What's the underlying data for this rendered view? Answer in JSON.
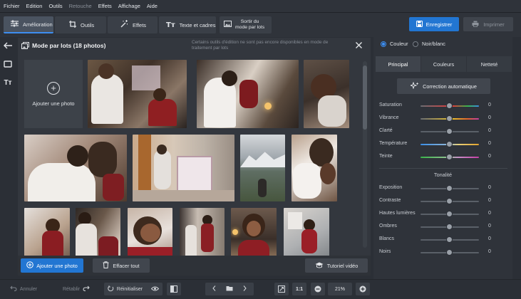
{
  "menu": [
    "Fichier",
    "Edition",
    "Outils",
    "Retouche",
    "Effets",
    "Affichage",
    "Aide"
  ],
  "menu_disabled": [
    "Retouche"
  ],
  "toolbar": {
    "tabs": [
      {
        "label": "Amélioration",
        "icon": "sliders-icon",
        "active": true
      },
      {
        "label": "Outils",
        "icon": "crop-icon",
        "active": false
      },
      {
        "label": "Effets",
        "icon": "magic-wand-icon",
        "active": false
      },
      {
        "label": "Texte et cadres",
        "icon": "text-icon",
        "active": false
      }
    ],
    "batch_line1": "Sortir du",
    "batch_line2": "mode par lots",
    "save_label": "Enregistrer",
    "print_label": "Imprimer"
  },
  "batch": {
    "title": "Mode par lots (18 photos)",
    "note": "Certains outils d'édition ne sont pas encore disponibles en mode de traitement par lots",
    "add_tile_label": "Ajouter une photo",
    "footer": {
      "add_label": "Ajouter une photo",
      "clear_label": "Effacer tout",
      "tutorial_label": "Tutoriel vidéo"
    }
  },
  "right_panel": {
    "color_label": "Couleur",
    "bw_label": "Noir/blanc",
    "tabs": [
      "Principal",
      "Couleurs",
      "Netteté"
    ],
    "auto_label": "Correction automatique",
    "sliders_top": [
      {
        "label": "Saturation",
        "value": "0",
        "track": "saturation"
      },
      {
        "label": "Vibrance",
        "value": "0",
        "track": "vibrance"
      },
      {
        "label": "Clarté",
        "value": "0",
        "track": "plain"
      },
      {
        "label": "Température",
        "value": "0",
        "track": "temperature"
      },
      {
        "label": "Teinte",
        "value": "0",
        "track": "tint"
      }
    ],
    "tone_label": "Tonalité",
    "sliders_tone": [
      {
        "label": "Exposition",
        "value": "0"
      },
      {
        "label": "Contraste",
        "value": "0"
      },
      {
        "label": "Hautes lumières",
        "value": "0"
      },
      {
        "label": "Ombres",
        "value": "0"
      },
      {
        "label": "Blancs",
        "value": "0"
      },
      {
        "label": "Noirs",
        "value": "0"
      }
    ]
  },
  "bottom": {
    "undo_label": "Annuler",
    "redo_label": "Rétablir",
    "reset_label": "Réinitialiser",
    "fit_label": "1:1",
    "zoom_value": "21%"
  },
  "colors": {
    "accent": "#2276d2",
    "panel": "#33373e",
    "background": "#2b2f36"
  }
}
